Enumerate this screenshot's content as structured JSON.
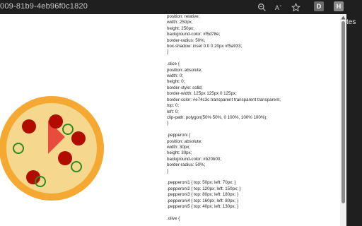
{
  "browser": {
    "url_fragment": "009-81b9-4eb96f0c1820",
    "icons": [
      "zoom-out-icon",
      "read-aloud-icon",
      "favorite-star-icon"
    ],
    "extensions": [
      {
        "label": "D"
      },
      {
        "label": "H"
      }
    ],
    "settings_icon": "gear-icon"
  },
  "side_panel": {
    "label": "tes"
  },
  "pizza": {
    "crust_color": "#f5a933",
    "base_color": "#f5d78e",
    "slice_color": "#e74c3c",
    "pepperoni_color": "#b20b00",
    "olive_color": "#2e8b1f"
  },
  "code_lines": [
    "position: relative;",
    "width: 250px;",
    "height: 250px;",
    "background-color: #f5d78e;",
    "border-radius: 50%;",
    "box-shadow: inset 0 0 0 20px #f5a933;",
    "}",
    "",
    ".slice {",
    "position: absolute;",
    "width: 0;",
    "height: 0;",
    "border-style: solid;",
    "border-width: 125px 125px 0 125px;",
    "border-color: #e74c3c transparent transparent transparent;",
    "top: 0;",
    "left: 0;",
    "clip-path: polygon(50% 50%, 0 100%, 100% 100%);",
    "}",
    "",
    ".pepperoni {",
    "position: absolute;",
    "width: 30px;",
    "height: 30px;",
    "background-color: #b20b00;",
    "border-radius: 50%;",
    "}",
    "",
    ".pepperoni1 { top: 50px; left: 70px; }",
    ".pepperoni2 { top: 120px; left: 150px; }",
    ".pepperoni3 { top: 80px; left: 180px; }",
    ".pepperoni4 { top: 160px; left: 80px; }",
    ".pepperoni5 { top: 40px; left: 130px; }",
    "",
    ".olive {"
  ]
}
